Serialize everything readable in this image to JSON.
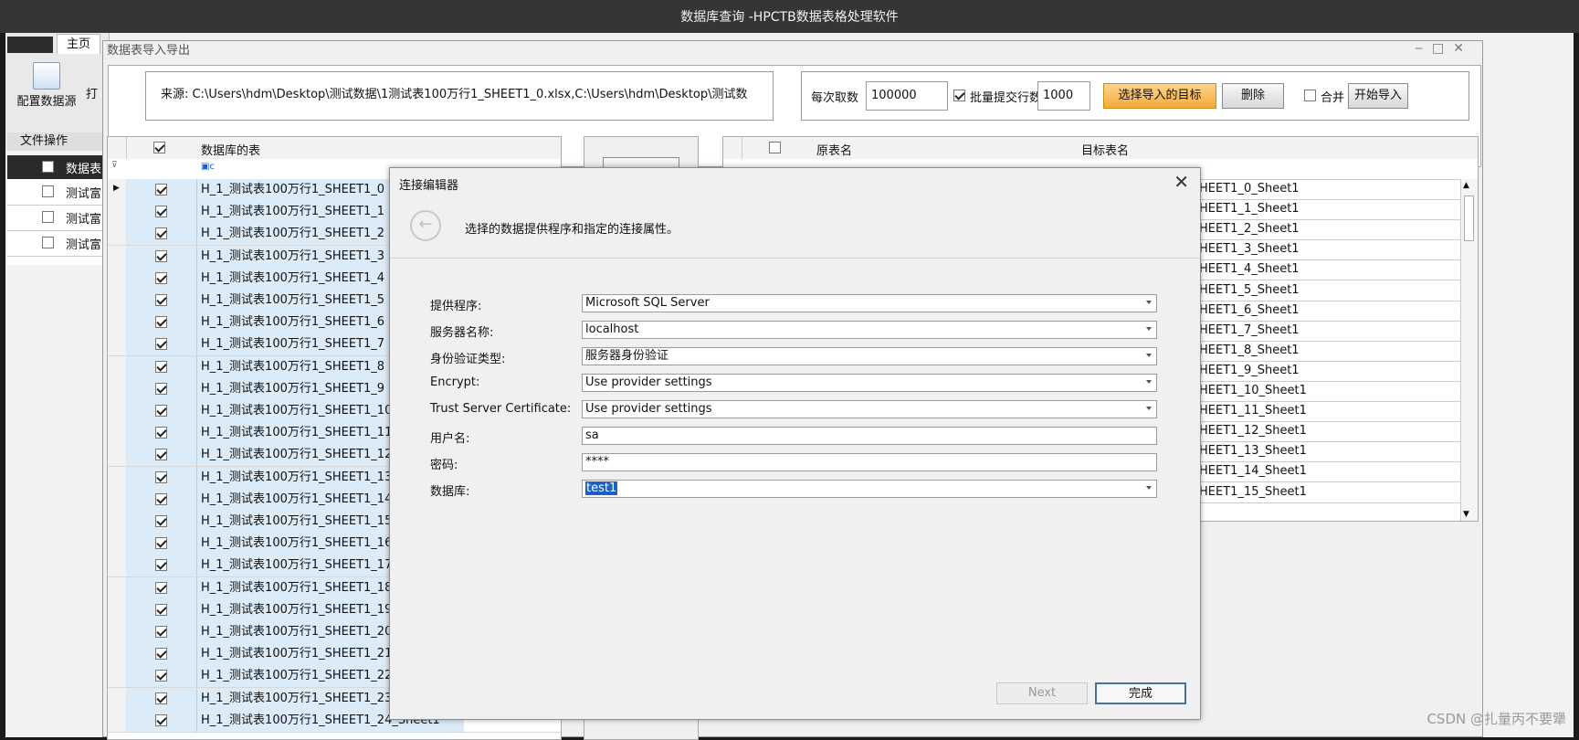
{
  "window": {
    "title": "数据库查询 -HPCTB数据表格处理软件"
  },
  "ribbon": {
    "home_tab": "主页",
    "config_button": "配置数据源",
    "group_label": "文件操作",
    "partial_button": "打"
  },
  "left_panel": {
    "header": "数据表",
    "rows": [
      "测试富",
      "测试富",
      "测试富"
    ]
  },
  "subwindow": {
    "title": "数据表导入导出"
  },
  "top": {
    "source": "来源:  C:\\Users\\hdm\\Desktop\\测试数据\\1测试表100万行1_SHEET1_0.xlsx,C:\\Users\\hdm\\Desktop\\测试数",
    "per_fetch_label": "每次取数",
    "per_fetch_value": "100000",
    "batch_label": "批量提交行数",
    "batch_value": "1000",
    "select_target": "选择导入的目标",
    "delete": "删除",
    "merge": "合并",
    "start": "开始导入"
  },
  "left_grid": {
    "header": "数据库的表",
    "filter_icon": "abc-filter-icon",
    "rows": [
      "H_1_测试表100万行1_SHEET1_0",
      "H_1_测试表100万行1_SHEET1_1",
      "H_1_测试表100万行1_SHEET1_2",
      "H_1_测试表100万行1_SHEET1_3",
      "H_1_测试表100万行1_SHEET1_4",
      "H_1_测试表100万行1_SHEET1_5",
      "H_1_测试表100万行1_SHEET1_6",
      "H_1_测试表100万行1_SHEET1_7",
      "H_1_测试表100万行1_SHEET1_8",
      "H_1_测试表100万行1_SHEET1_9",
      "H_1_测试表100万行1_SHEET1_10",
      "H_1_测试表100万行1_SHEET1_11",
      "H_1_测试表100万行1_SHEET1_12",
      "H_1_测试表100万行1_SHEET1_13",
      "H_1_测试表100万行1_SHEET1_14",
      "H_1_测试表100万行1_SHEET1_15",
      "H_1_测试表100万行1_SHEET1_16",
      "H_1_测试表100万行1_SHEET1_17",
      "H_1_测试表100万行1_SHEET1_18",
      "H_1_测试表100万行1_SHEET1_19",
      "H_1_测试表100万行1_SHEET1_20",
      "H_1_测试表100万行1_SHEET1_21",
      "H_1_测试表100万行1_SHEET1_22",
      "H_1_测试表100万行1_SHEET1_23",
      "H_1_测试表100万行1_SHEET1_24_Sheet1"
    ]
  },
  "right_grid": {
    "col_source": "原表名",
    "col_target": "目标表名",
    "rows": [
      "1_SHEET1_0_Sheet1",
      "1_SHEET1_1_Sheet1",
      "1_SHEET1_2_Sheet1",
      "1_SHEET1_3_Sheet1",
      "1_SHEET1_4_Sheet1",
      "1_SHEET1_5_Sheet1",
      "1_SHEET1_6_Sheet1",
      "1_SHEET1_7_Sheet1",
      "1_SHEET1_8_Sheet1",
      "1_SHEET1_9_Sheet1",
      "1_SHEET1_10_Sheet1",
      "1_SHEET1_11_Sheet1",
      "1_SHEET1_12_Sheet1",
      "1_SHEET1_13_Sheet1",
      "1_SHEET1_14_Sheet1",
      "1_SHEET1_15_Sheet1"
    ]
  },
  "dialog": {
    "title": "连接编辑器",
    "description": "选择的数据提供程序和指定的连接属性。",
    "fields": {
      "provider": {
        "label": "提供程序:",
        "value": "Microsoft SQL Server"
      },
      "server": {
        "label": "服务器名称:",
        "value": "localhost"
      },
      "auth": {
        "label": "身份验证类型:",
        "value": "服务器身份验证"
      },
      "encrypt": {
        "label": "Encrypt:",
        "value": "Use provider settings"
      },
      "trust": {
        "label": "Trust Server Certificate:",
        "value": "Use provider settings"
      },
      "user": {
        "label": "用户名:",
        "value": "sa"
      },
      "password": {
        "label": "密码:",
        "value": "****"
      },
      "database": {
        "label": "数据库:",
        "value": "test1"
      }
    },
    "next": "Next",
    "finish": "完成"
  },
  "watermark": "CSDN @扎量丙不要犟",
  "colors": {
    "accent": "#1c5fc7",
    "orange": "#f3a93a",
    "row_highlight": "#dcebf8"
  }
}
